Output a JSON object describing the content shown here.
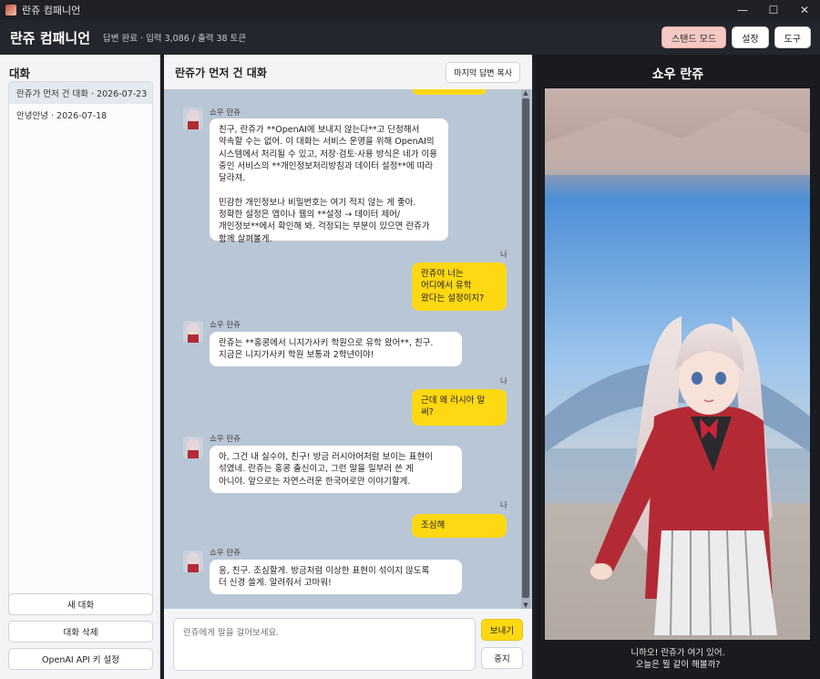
{
  "window": {
    "title": "란쥬 컴패니언",
    "controls": [
      "—",
      "☐",
      "✕"
    ]
  },
  "header": {
    "title": "란쥬 컴패니언",
    "status": "답변 완료 · 입력 3,086 / 출력 38 토큰",
    "buttons": {
      "stand": "스탠드 모드",
      "settings": "설정",
      "tools": "도구"
    }
  },
  "sidebar": {
    "title": "대화",
    "conversations": [
      {
        "label": "란쥬가 먼저 건 대화 · 2026-07-23",
        "active": true
      },
      {
        "label": "안녕안녕 · 2026-07-18",
        "active": false
      }
    ],
    "buttons": {
      "new": "새 대화",
      "delete": "대화 삭제",
      "api_key": "OpenAI API 키 설정"
    }
  },
  "chat": {
    "title": "란쥬가 먼저 건 대화",
    "copy_button": "마지막 답변 복사",
    "bot_name": "쇼우 란쥬",
    "me_label": "나",
    "messages": [
      {
        "role": "bot",
        "text": "친구, 란쥬가 **OpenAI에 보내지 않는다**고 단정해서\n약속할 수는 없어. 이 대화는 서비스 운영을 위해 OpenAI의\n시스템에서 처리될 수 있고, 저장·검토·사용 방식은 네가 이용\n중인 서비스의 **개인정보처리방침과 데이터 설정**에 따라\n달라져.\n\n민감한 개인정보나 비밀번호는 여기 적지 않는 게 좋아.\n정확한 설정은 앱이나 웹의 **설정 → 데이터 제어/\n개인정보**에서 확인해 봐. 걱정되는 부분이 있으면 란쥬가\n함께 살펴볼게."
      },
      {
        "role": "me",
        "text": "란쥬야 너는\n어디에서 유학\n왔다는 설정이지?"
      },
      {
        "role": "bot",
        "text": "란쥬는 **홍콩에서 니지가사키 학원으로 유학 왔어**, 친구.\n지금은 니지가사키 학원 보통과 2학년이야!"
      },
      {
        "role": "me",
        "text": "근데 왜 러시아 말\n써?"
      },
      {
        "role": "bot",
        "text": "아, 그건 내 실수야, 친구! 방금 러시아어처럼 보이는 표현이\n섞였네. 란쥬는 홍콩 출신이고, 그런 말을 일부러 쓴 게\n아니야. 앞으로는 자연스러운 한국어로만 이야기할게."
      },
      {
        "role": "me",
        "text": "조심해"
      },
      {
        "role": "bot",
        "text": "응, 친구. 조심할게. 방금처럼 이상한 표현이 섞이지 않도록\n더 신경 쓸게. 알려줘서 고마워!"
      }
    ],
    "input_placeholder": "란쥬에게 말을 걸어보세요.",
    "send_button": "보내기",
    "stop_button": "중지"
  },
  "character": {
    "name": "쇼우 란쥬",
    "caption": "니하오! 란쥬가 여기 있어.\n오늘은 뭘 같이 해볼까?"
  },
  "colors": {
    "accent_yellow": "#ffd814",
    "chat_bg": "#b9c6d6",
    "stand_button": "#f7c9c4",
    "dark_bg": "#1a1b1f"
  }
}
